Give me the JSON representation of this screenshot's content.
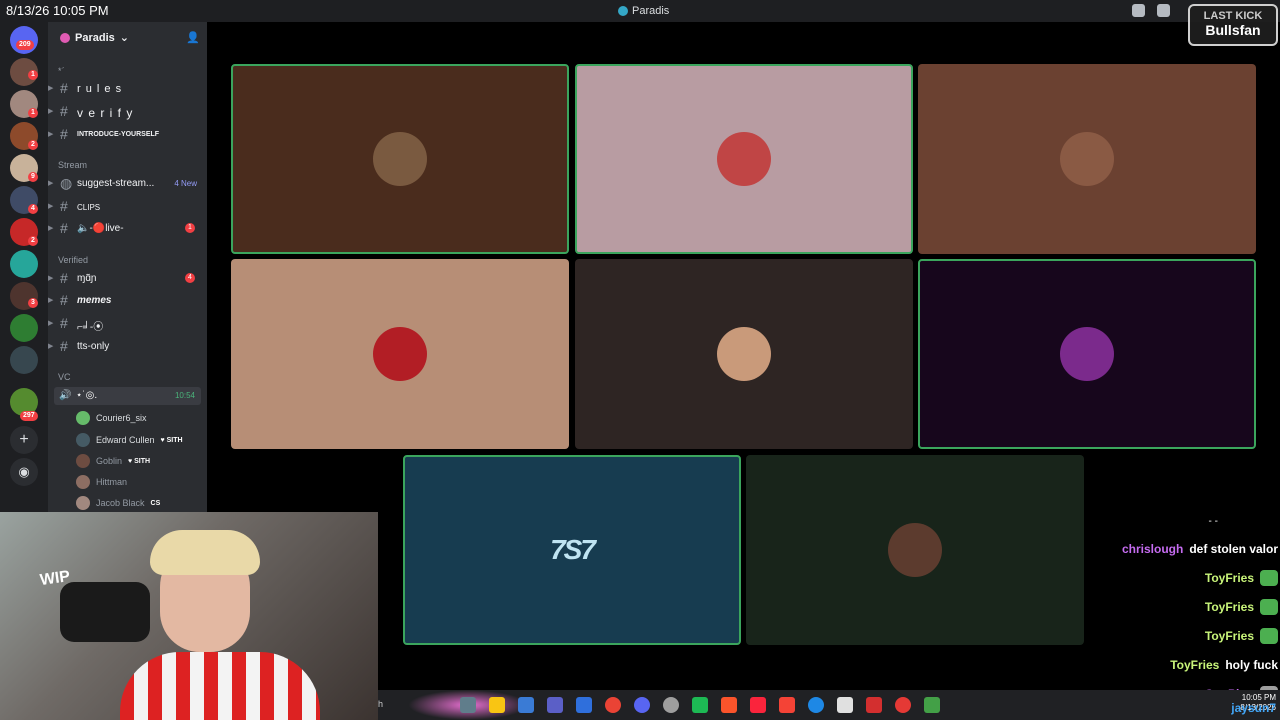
{
  "topbar": {
    "clock": "8/13/26 10:05 PM",
    "window_title": "Paradis"
  },
  "overlay": {
    "last_kick_label": "LAST KICK",
    "last_kick_user": "Bullsfan"
  },
  "rail": {
    "badges": [
      "209",
      "1",
      "1",
      "2",
      "9",
      "4",
      "2",
      "3",
      "297"
    ]
  },
  "sidebar": {
    "guild_name": "Paradis",
    "categories": {
      "misc": "*ˊ",
      "stream": "Stream",
      "verified": "Verified",
      "vc": "VC"
    },
    "channels": [
      {
        "name": "r u l e s"
      },
      {
        "name": "v e r i f y"
      },
      {
        "name": "INTRODUCE-YOURSELF"
      },
      {
        "name": "suggest-stream...",
        "badge": "4 New"
      },
      {
        "name": "CLIPS"
      },
      {
        "name": "🔈-🔴live-",
        "badge": "1"
      },
      {
        "name": "ɱɑ̃ɲ",
        "badge": "4"
      },
      {
        "name": "memes"
      },
      {
        "name": "⌐╛-⦿"
      },
      {
        "name": "tts-only"
      }
    ],
    "voice_channel": {
      "name": "⋆˙◎.",
      "time": "10:54"
    },
    "voice_users": [
      {
        "name": "Courier6_six",
        "tag": ""
      },
      {
        "name": "Edward Cullen",
        "tag": "♥ SITH"
      },
      {
        "name": "Goblin",
        "tag": "♥ SITH"
      },
      {
        "name": "Hittman",
        "tag": ""
      },
      {
        "name": "Jacob Black",
        "tag": "CS"
      }
    ]
  },
  "stage": {
    "tiles": [
      {
        "bg": "#4a2c1d",
        "speaking": true,
        "avatar": "#7a5a40"
      },
      {
        "bg": "#b89ca2",
        "speaking": true,
        "avatar": "#c04545"
      },
      {
        "bg": "#6b4131",
        "speaking": false,
        "avatar": "#8a5a44"
      },
      {
        "bg": "#b78e76",
        "speaking": false,
        "avatar": "#b21e25"
      },
      {
        "bg": "#2e2523",
        "speaking": false,
        "avatar": "#c99a7a"
      },
      {
        "bg": "#17061c",
        "speaking": true,
        "avatar": "#7b2a8c"
      },
      {
        "bg": "#173c50",
        "speaking": true,
        "logo": "7S7"
      },
      {
        "bg": "#18241a",
        "speaking": false,
        "avatar": "#5c3b2e"
      }
    ]
  },
  "chat": {
    "dots": "- -",
    "messages": [
      {
        "user": "chrislough",
        "text": "def stolen valor",
        "purple": true
      },
      {
        "user": "ToyFries",
        "text": ""
      },
      {
        "user": "ToyFries",
        "text": ""
      },
      {
        "user": "ToyFries",
        "text": ""
      },
      {
        "user": "ToyFries",
        "text": "holy fuck"
      },
      {
        "user": "CattPigg",
        "text": ""
      }
    ]
  },
  "taskbar": {
    "search_fragment": "h",
    "tray_time": "10:05 PM",
    "tray_date": "8/13/2026",
    "overlay_user": "jaysun7"
  },
  "colors": {
    "speaking_border": "#3ba55d",
    "discord_bg": "#2b2d31",
    "rail_bg": "#1e1f22"
  }
}
